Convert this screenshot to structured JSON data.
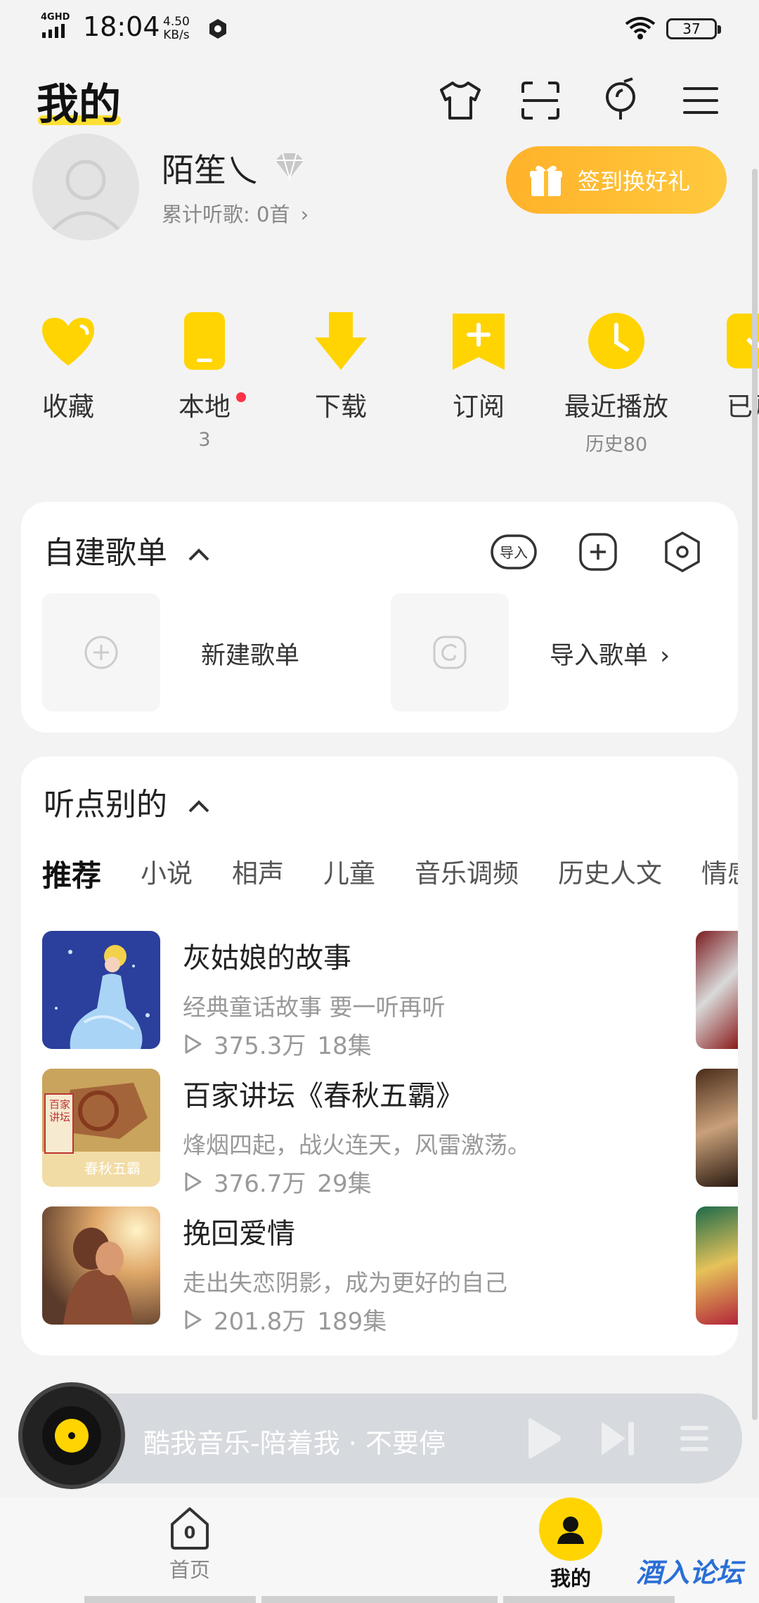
{
  "status_bar": {
    "network": "4GHD",
    "time": "18:04",
    "net_speed_value": "4.50",
    "net_speed_unit": "KB/s",
    "battery": "37"
  },
  "header": {
    "title": "我的",
    "icons": [
      "tshirt-icon",
      "scan-icon",
      "mic-icon",
      "menu-icon"
    ]
  },
  "profile": {
    "username": "陌笙乀",
    "listen_count": "累计听歌: 0首",
    "signin_label": "签到换好礼"
  },
  "quick_entries": [
    {
      "label": "收藏",
      "sub": "",
      "icon": "heart-icon"
    },
    {
      "label": "本地",
      "sub": "3",
      "icon": "phone-icon",
      "badge": true
    },
    {
      "label": "下载",
      "sub": "",
      "icon": "download-icon"
    },
    {
      "label": "订阅",
      "sub": "",
      "icon": "subscribe-icon"
    },
    {
      "label": "最近播放",
      "sub": "历史80",
      "icon": "clock-icon"
    },
    {
      "label": "已购",
      "sub": "",
      "icon": "purchased-icon"
    }
  ],
  "playlist_card": {
    "title": "自建歌单",
    "import_badge": "导入",
    "new_label": "新建歌单",
    "import_label": "导入歌单"
  },
  "listen_card": {
    "title": "听点别的",
    "tabs": [
      "推荐",
      "小说",
      "相声",
      "儿童",
      "音乐调频",
      "历史人文",
      "情感"
    ],
    "items": [
      {
        "title": "灰姑娘的故事",
        "desc": "经典童话故事 要一听再听",
        "plays": "375.3万",
        "episodes": "18集"
      },
      {
        "title": "百家讲坛《春秋五霸》",
        "desc": "烽烟四起，战火连天，风雷激荡。",
        "plays": "376.7万",
        "episodes": "29集",
        "cover_text_side": "百家讲坛",
        "cover_text_bottom": "春秋五霸"
      },
      {
        "title": "挽回爱情",
        "desc": "走出失恋阴影，成为更好的自己",
        "plays": "201.8万",
        "episodes": "189集"
      }
    ]
  },
  "player": {
    "text": "酷我音乐-陪着我 · 不要停"
  },
  "bottom_nav": {
    "home_label": "首页",
    "home_badge": "0",
    "mine_label": "我的"
  },
  "watermark": "酒入论坛",
  "colors": {
    "accent": "#ffd400",
    "signin": "#ffb22a",
    "badge": "#ff3347"
  }
}
